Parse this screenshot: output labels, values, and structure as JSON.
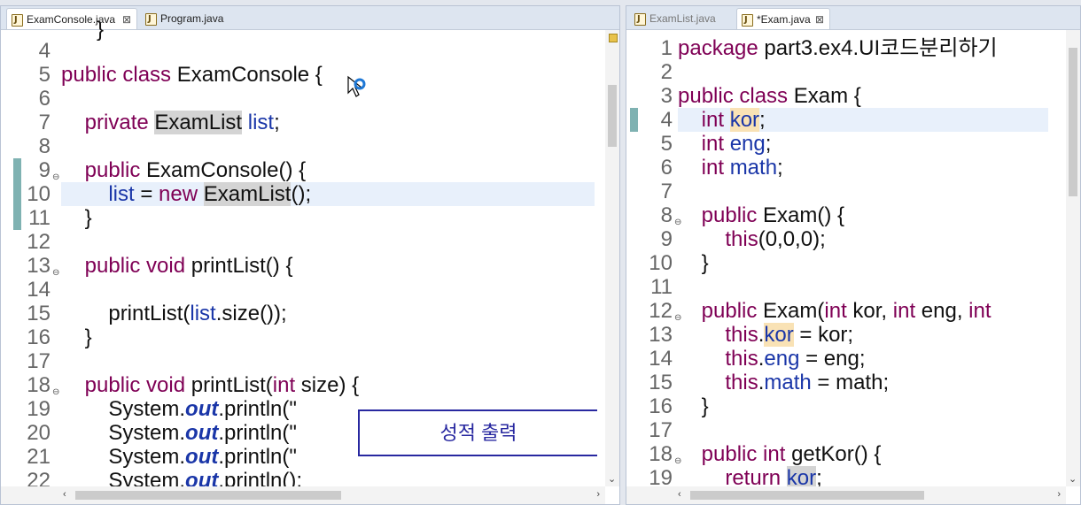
{
  "left_editor": {
    "tabs": [
      {
        "label": "ExamConsole.java",
        "close": "⊠",
        "icon": "java-file-icon"
      },
      {
        "label": "Program.java",
        "icon": "java-file-icon"
      }
    ],
    "lines": [
      {
        "n": "4",
        "parts": []
      },
      {
        "n": "5",
        "parts": [
          [
            "kw",
            "public class "
          ],
          [
            "t",
            "ExamConsole {"
          ]
        ]
      },
      {
        "n": "6",
        "parts": []
      },
      {
        "n": "7",
        "parts": [
          [
            "t",
            "    "
          ],
          [
            "kw",
            "private "
          ],
          [
            "hl",
            "ExamList"
          ],
          [
            "t",
            " "
          ],
          [
            "fld",
            "list"
          ],
          [
            "t",
            ";"
          ]
        ]
      },
      {
        "n": "8",
        "parts": []
      },
      {
        "n": "9",
        "parts": [
          [
            "t",
            "    "
          ],
          [
            "kw",
            "public "
          ],
          [
            "t",
            "ExamConsole() {"
          ]
        ],
        "fold": true
      },
      {
        "n": "10",
        "parts": [
          [
            "t",
            "        "
          ],
          [
            "fld",
            "list"
          ],
          [
            "t",
            " = "
          ],
          [
            "kw",
            "new "
          ],
          [
            "hl",
            "ExamList"
          ],
          [
            "t",
            "();"
          ]
        ]
      },
      {
        "n": "11",
        "parts": [
          [
            "t",
            "    }"
          ]
        ]
      },
      {
        "n": "12",
        "parts": []
      },
      {
        "n": "13",
        "parts": [
          [
            "t",
            "    "
          ],
          [
            "kw",
            "public void "
          ],
          [
            "t",
            "printList() {"
          ]
        ],
        "fold": true
      },
      {
        "n": "14",
        "parts": []
      },
      {
        "n": "15",
        "parts": [
          [
            "t",
            "        printList("
          ],
          [
            "fld",
            "list"
          ],
          [
            "t",
            ".size());"
          ]
        ]
      },
      {
        "n": "16",
        "parts": [
          [
            "t",
            "    }"
          ]
        ]
      },
      {
        "n": "17",
        "parts": []
      },
      {
        "n": "18",
        "parts": [
          [
            "t",
            "    "
          ],
          [
            "kw",
            "public void "
          ],
          [
            "t",
            "printList("
          ],
          [
            "kw",
            "int "
          ],
          [
            "t",
            "size) {"
          ]
        ],
        "fold": true
      },
      {
        "n": "19",
        "parts": [
          [
            "t",
            "        System."
          ],
          [
            "it",
            "out"
          ],
          [
            "t",
            ".println(\""
          ]
        ]
      },
      {
        "n": "20",
        "parts": [
          [
            "t",
            "        System."
          ],
          [
            "it",
            "out"
          ],
          [
            "t",
            ".println(\""
          ]
        ]
      },
      {
        "n": "21",
        "parts": [
          [
            "t",
            "        System."
          ],
          [
            "it",
            "out"
          ],
          [
            "t",
            ".println(\""
          ]
        ]
      },
      {
        "n": "22",
        "parts": [
          [
            "t",
            "        System."
          ],
          [
            "it",
            "out"
          ],
          [
            "t",
            ".println();"
          ]
        ]
      }
    ],
    "string_literal_box": "성적  출력",
    "top_partial": "} "
  },
  "right_editor": {
    "tabs": [
      {
        "label": "ExamList.java",
        "icon": "java-file-icon"
      },
      {
        "label": "*Exam.java",
        "close": "⊠",
        "icon": "java-file-icon"
      }
    ],
    "lines": [
      {
        "n": "1",
        "parts": [
          [
            "kw",
            "package "
          ],
          [
            "t",
            "part3.ex4.UI코드분리하기"
          ]
        ]
      },
      {
        "n": "2",
        "parts": []
      },
      {
        "n": "3",
        "parts": [
          [
            "kw",
            "public class "
          ],
          [
            "t",
            "Exam {"
          ]
        ]
      },
      {
        "n": "4",
        "parts": [
          [
            "t",
            "    "
          ],
          [
            "kw",
            "int "
          ],
          [
            "hl2",
            "kor"
          ],
          [
            "t",
            ";"
          ]
        ]
      },
      {
        "n": "5",
        "parts": [
          [
            "t",
            "    "
          ],
          [
            "kw",
            "int "
          ],
          [
            "fld",
            "eng"
          ],
          [
            "t",
            ";"
          ]
        ]
      },
      {
        "n": "6",
        "parts": [
          [
            "t",
            "    "
          ],
          [
            "kw",
            "int "
          ],
          [
            "fld",
            "math"
          ],
          [
            "t",
            ";"
          ]
        ]
      },
      {
        "n": "7",
        "parts": []
      },
      {
        "n": "8",
        "parts": [
          [
            "t",
            "    "
          ],
          [
            "kw",
            "public "
          ],
          [
            "t",
            "Exam() {"
          ]
        ],
        "fold": true
      },
      {
        "n": "9",
        "parts": [
          [
            "t",
            "        "
          ],
          [
            "kw",
            "this"
          ],
          [
            "t",
            "(0,0,0);"
          ]
        ]
      },
      {
        "n": "10",
        "parts": [
          [
            "t",
            "    }"
          ]
        ]
      },
      {
        "n": "11",
        "parts": []
      },
      {
        "n": "12",
        "parts": [
          [
            "t",
            "    "
          ],
          [
            "kw",
            "public "
          ],
          [
            "t",
            "Exam("
          ],
          [
            "kw",
            "int "
          ],
          [
            "t",
            "kor, "
          ],
          [
            "kw",
            "int "
          ],
          [
            "t",
            "eng, "
          ],
          [
            "kw",
            "int"
          ]
        ],
        "fold": true
      },
      {
        "n": "13",
        "parts": [
          [
            "t",
            "        "
          ],
          [
            "kw",
            "this"
          ],
          [
            "t",
            "."
          ],
          [
            "hl2f",
            "kor"
          ],
          [
            "t",
            " = kor;"
          ]
        ]
      },
      {
        "n": "14",
        "parts": [
          [
            "t",
            "        "
          ],
          [
            "kw",
            "this"
          ],
          [
            "t",
            "."
          ],
          [
            "fld",
            "eng"
          ],
          [
            "t",
            " = eng;"
          ]
        ]
      },
      {
        "n": "15",
        "parts": [
          [
            "t",
            "        "
          ],
          [
            "kw",
            "this"
          ],
          [
            "t",
            "."
          ],
          [
            "fld",
            "math"
          ],
          [
            "t",
            " = math;"
          ]
        ]
      },
      {
        "n": "16",
        "parts": [
          [
            "t",
            "    }"
          ]
        ]
      },
      {
        "n": "17",
        "parts": []
      },
      {
        "n": "18",
        "parts": [
          [
            "t",
            "    "
          ],
          [
            "kw",
            "public int "
          ],
          [
            "t",
            "getKor() {"
          ]
        ],
        "fold": true
      },
      {
        "n": "19",
        "parts": [
          [
            "t",
            "        "
          ],
          [
            "kw",
            "return "
          ],
          [
            "hlf",
            "kor"
          ],
          [
            "t",
            ";"
          ]
        ]
      }
    ]
  },
  "icons": {
    "cursor": "mouse-pointer-icon",
    "busy": "busy-spinner-icon",
    "fold": "collapse-icon"
  },
  "colors": {
    "keyword": "#7f0055",
    "field": "#1a36a8",
    "box_border": "#2828a0"
  }
}
